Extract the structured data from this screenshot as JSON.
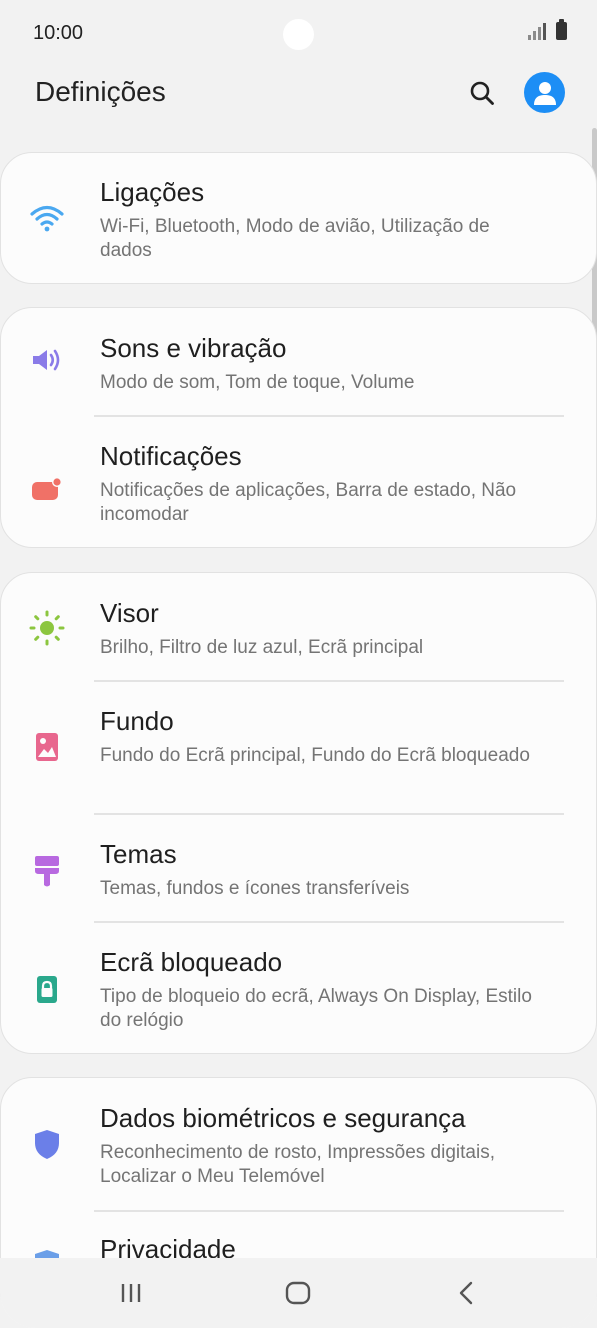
{
  "status": {
    "time": "10:00"
  },
  "header": {
    "title": "Definições"
  },
  "sections": [
    {
      "items": [
        {
          "icon": "wifi-icon",
          "color": "#4aa8f0",
          "title": "Ligações",
          "subtitle": "Wi-Fi, Bluetooth, Modo de avião, Utilização de dados"
        }
      ]
    },
    {
      "items": [
        {
          "icon": "volume-icon",
          "color": "#8a7be8",
          "title": "Sons e vibração",
          "subtitle": "Modo de som, Tom de toque, Volume"
        },
        {
          "icon": "notification-icon",
          "color": "#f07167",
          "title": "Notificações",
          "subtitle": "Notificações de aplicações, Barra de estado, Não incomodar"
        }
      ]
    },
    {
      "items": [
        {
          "icon": "brightness-icon",
          "color": "#8cc63f",
          "title": "Visor",
          "subtitle": "Brilho, Filtro de luz azul, Ecrã principal"
        },
        {
          "icon": "wallpaper-icon",
          "color": "#e8678e",
          "title": "Fundo",
          "subtitle": "Fundo do Ecrã principal, Fundo do Ecrã bloqueado"
        },
        {
          "icon": "theme-brush-icon",
          "color": "#b869e0",
          "title": "Temas",
          "subtitle": "Temas, fundos e ícones transferíveis"
        },
        {
          "icon": "lock-icon",
          "color": "#2aa88c",
          "title": "Ecrã bloqueado",
          "subtitle": "Tipo de bloqueio do ecrã, Always On Display, Estilo do relógio"
        }
      ]
    },
    {
      "items": [
        {
          "icon": "shield-icon",
          "color": "#6b7fe8",
          "title": "Dados biométricos e segurança",
          "subtitle": "Reconhecimento de rosto, Impressões digitais, Localizar o Meu Telemóvel"
        },
        {
          "icon": "privacy-shield-icon",
          "color": "#6b9fe8",
          "title": "Privacidade",
          "subtitle": ""
        }
      ]
    }
  ]
}
